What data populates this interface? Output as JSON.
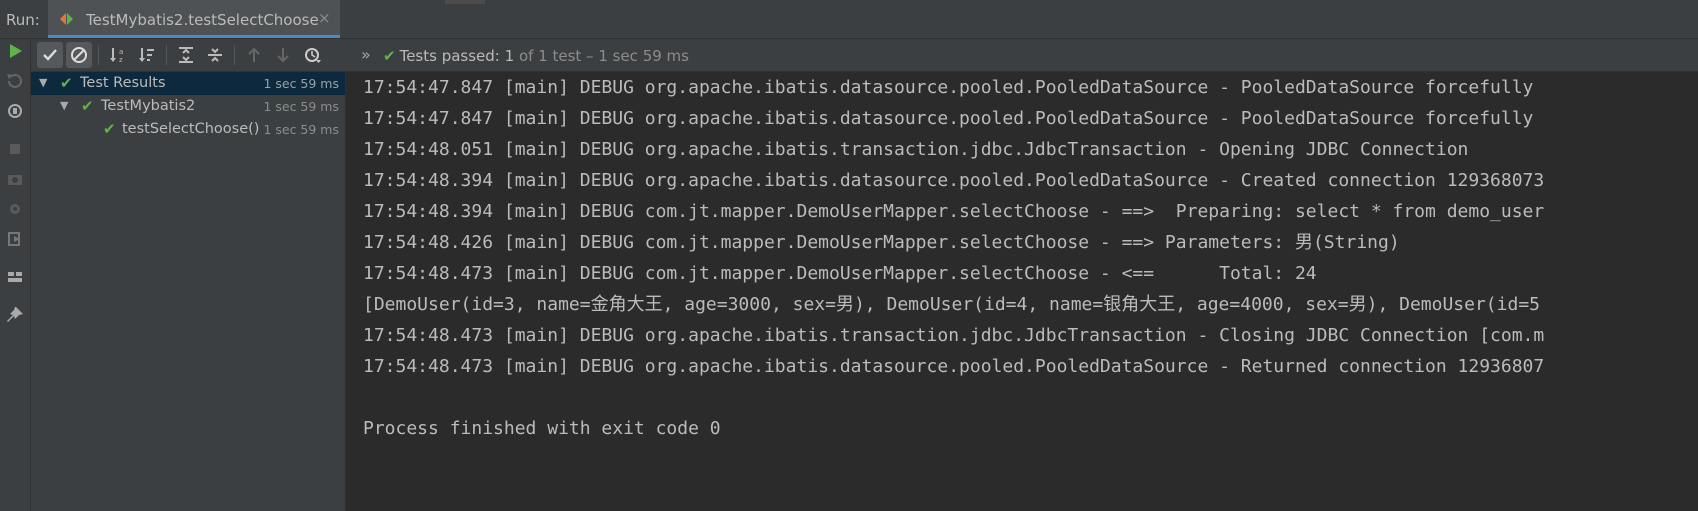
{
  "runbar": {
    "label": "Run:",
    "tab_title": "TestMybatis2.testSelectChoose",
    "close_glyph": "×"
  },
  "toolbar": {
    "icons": [
      "rerun-icon",
      "show-passed-icon",
      "show-ignored-icon",
      "sort-alpha-icon",
      "sort-duration-icon",
      "expand-all-icon",
      "collapse-all-icon",
      "prev-failed-icon",
      "next-failed-icon",
      "history-icon"
    ],
    "more_glyph": "»",
    "status_check": "✔",
    "status_main": "Tests passed: 1",
    "status_sub": " of 1 test – 1 sec 59 ms"
  },
  "tree": {
    "rows": [
      {
        "name": "Test Results",
        "time": "1 sec 59 ms"
      },
      {
        "name": "TestMybatis2",
        "time": "1 sec 59 ms"
      },
      {
        "name": "testSelectChoose()",
        "time": "1 sec 59 ms"
      }
    ]
  },
  "console": {
    "lines": [
      "17:54:47.847 [main] DEBUG org.apache.ibatis.datasource.pooled.PooledDataSource - PooledDataSource forcefully",
      "17:54:47.847 [main] DEBUG org.apache.ibatis.datasource.pooled.PooledDataSource - PooledDataSource forcefully",
      "17:54:48.051 [main] DEBUG org.apache.ibatis.transaction.jdbc.JdbcTransaction - Opening JDBC Connection",
      "17:54:48.394 [main] DEBUG org.apache.ibatis.datasource.pooled.PooledDataSource - Created connection 129368073",
      "17:54:48.394 [main] DEBUG com.jt.mapper.DemoUserMapper.selectChoose - ==>  Preparing: select * from demo_user",
      "17:54:48.426 [main] DEBUG com.jt.mapper.DemoUserMapper.selectChoose - ==> Parameters: 男(String)",
      "17:54:48.473 [main] DEBUG com.jt.mapper.DemoUserMapper.selectChoose - <==      Total: 24",
      "[DemoUser(id=3, name=金角大王, age=3000, sex=男), DemoUser(id=4, name=银角大王, age=4000, sex=男), DemoUser(id=5",
      "17:54:48.473 [main] DEBUG org.apache.ibatis.transaction.jdbc.JdbcTransaction - Closing JDBC Connection [com.m",
      "17:54:48.473 [main] DEBUG org.apache.ibatis.datasource.pooled.PooledDataSource - Returned connection 12936807",
      "",
      "Process finished with exit code 0"
    ]
  },
  "left_strip": {
    "icons": [
      "run-icon",
      "rerun-failed-icon",
      "toggle-autotest-icon",
      "stop-icon",
      "screenshot-icon",
      "debug-settings-icon",
      "exit-icon",
      "layout-icon",
      "pin-icon"
    ]
  },
  "colors": {
    "accent": "#4a88c7",
    "pass": "#5fb34a",
    "selected_row": "#0d293e",
    "console_bg": "#2b2b2b",
    "panel_bg": "#3c3f41"
  }
}
